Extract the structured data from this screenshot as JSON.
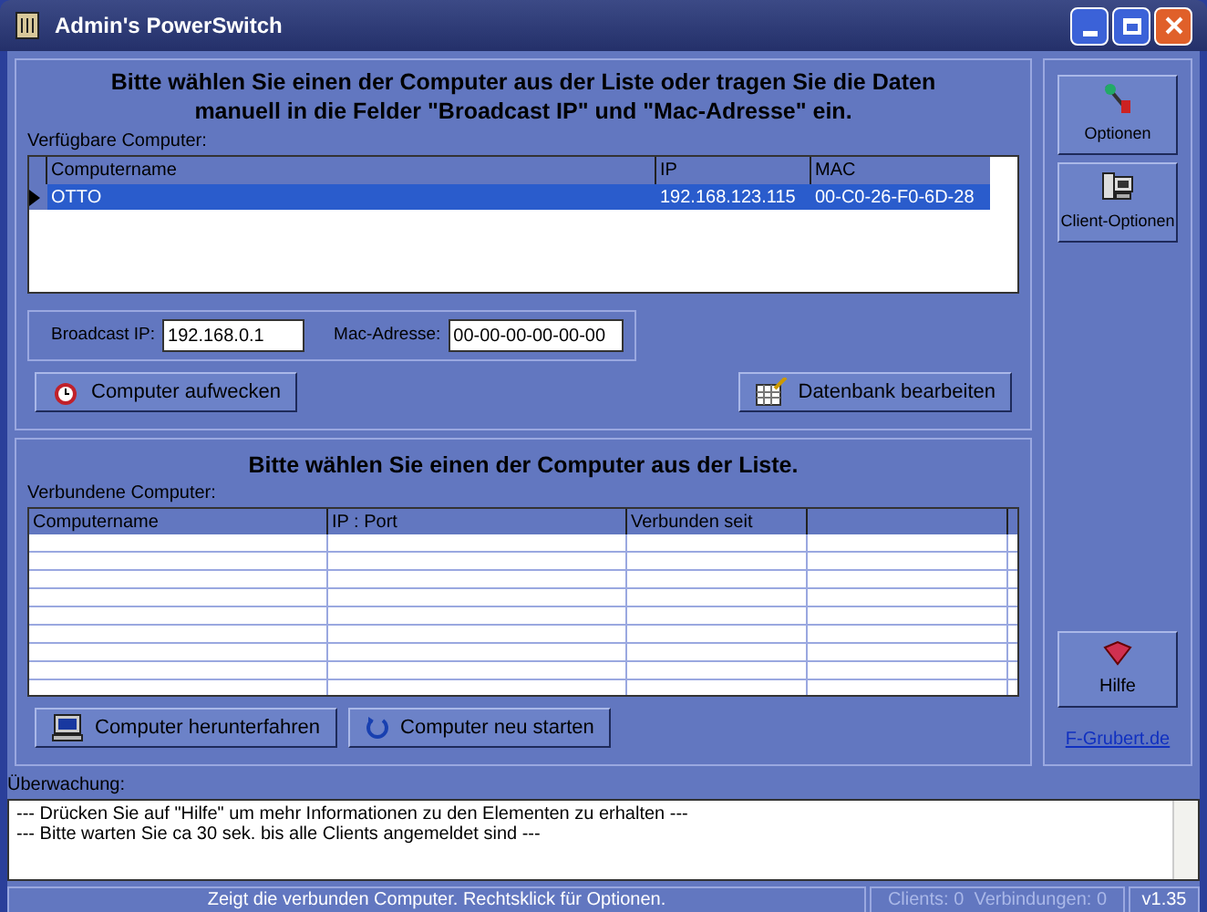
{
  "window": {
    "title": "Admin's PowerSwitch"
  },
  "top_group": {
    "heading": "Bitte wählen Sie einen der Computer aus der Liste oder tragen Sie die Daten manuell in die Felder \"Broadcast IP\" und \"Mac-Adresse\" ein.",
    "list_label": "Verfügbare Computer:",
    "columns": [
      "Computername",
      "IP",
      "MAC"
    ],
    "rows": [
      {
        "cells": [
          "OTTO",
          "192.168.123.115",
          "00-C0-26-F0-6D-28"
        ],
        "selected": true
      }
    ],
    "broadcast_label": "Broadcast IP:",
    "broadcast_value": "192.168.0.1",
    "mac_label": "Mac-Adresse:",
    "mac_value": "00-00-00-00-00-00",
    "buttons": [
      {
        "label": "Computer aufwecken",
        "kind": "alarm"
      },
      {
        "label": "Datenbank bearbeiten",
        "kind": "database"
      }
    ]
  },
  "bottom_group": {
    "heading": "Bitte wählen Sie einen der Computer aus der Liste.",
    "list_label": "Verbundene Computer:",
    "columns": [
      "Computername",
      "IP : Port",
      "Verbunden seit",
      ""
    ],
    "buttons": [
      {
        "label": "Computer herunterfahren",
        "kind": "computer"
      },
      {
        "label": "Computer neu starten",
        "kind": "restart"
      }
    ]
  },
  "sidebar": {
    "buttons": [
      {
        "label": "Optionen",
        "kind": "tools"
      },
      {
        "label": "Client-Optionen",
        "kind": "client"
      }
    ],
    "help": {
      "label": "Hilfe"
    },
    "link": "F-Grubert.de"
  },
  "monitor": {
    "label": "Überwachung:",
    "lines": [
      "--- Drücken Sie auf \"Hilfe\" um mehr Informationen zu den Elementen zu erhalten ---",
      "--- Bitte warten Sie ca 30 sek. bis alle Clients angemeldet sind ---"
    ]
  },
  "status_bar": {
    "message": "Zeigt die verbunden Computer. Rechtsklick für Optionen.",
    "counts": "Clients: 0  Verbindungen: 0",
    "version": "v1.35"
  }
}
